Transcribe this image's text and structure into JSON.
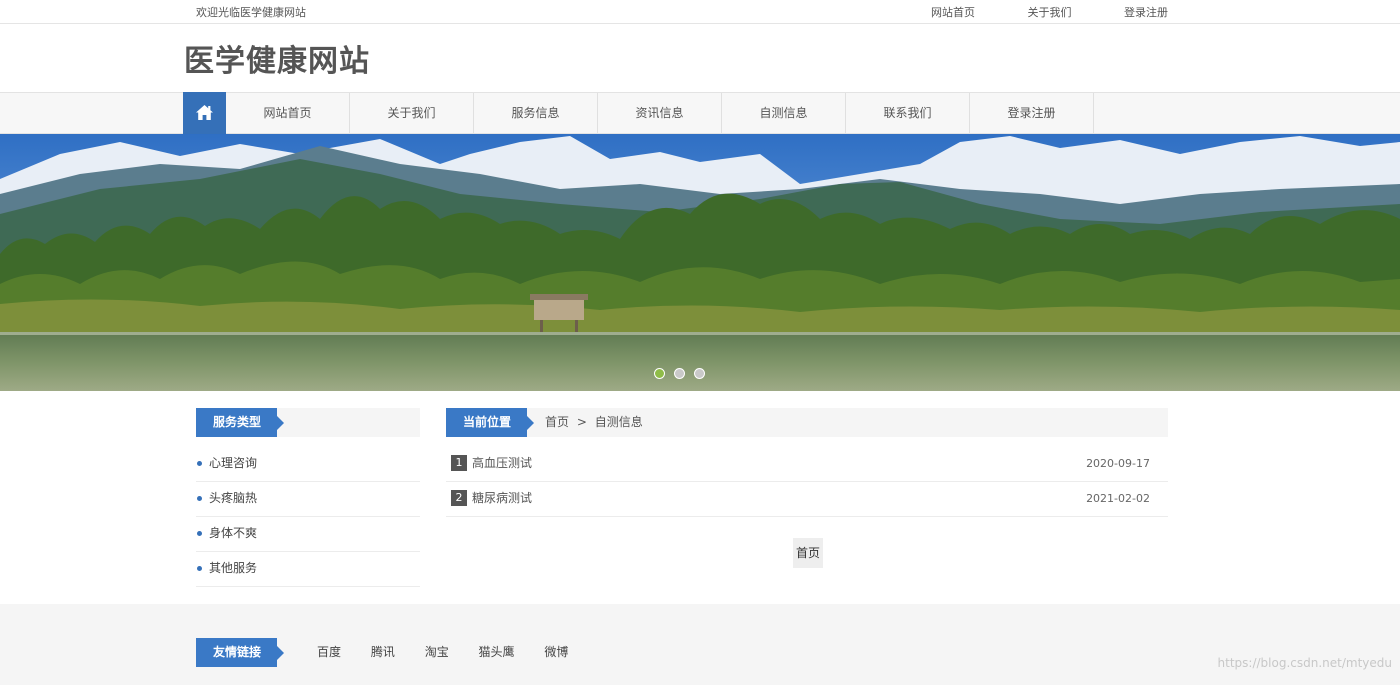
{
  "topbar": {
    "welcome": "欢迎光临医学健康网站",
    "links": [
      "网站首页",
      "关于我们",
      "登录注册"
    ]
  },
  "header": {
    "site_title": "医学健康网站"
  },
  "nav": {
    "home_icon": "home-icon",
    "items": [
      "网站首页",
      "关于我们",
      "服务信息",
      "资讯信息",
      "自测信息",
      "联系我们",
      "登录注册"
    ]
  },
  "banner": {
    "slide_count": 3,
    "active_slide": 1,
    "active_dot_color": "#8fbc48"
  },
  "sidebar": {
    "heading": "服务类型",
    "items": [
      "心理咨询",
      "头疼脑热",
      "身体不爽",
      "其他服务"
    ]
  },
  "content": {
    "location_label": "当前位置",
    "breadcrumb": {
      "home": "首页",
      "separator": ">",
      "current": "自测信息"
    },
    "rows": [
      {
        "num": "1",
        "title": "高血压测试",
        "date": "2020-09-17"
      },
      {
        "num": "2",
        "title": "糖尿病测试",
        "date": "2021-02-02"
      }
    ],
    "pager": {
      "first": "首页"
    }
  },
  "footer": {
    "heading": "友情链接",
    "links": [
      "百度",
      "腾讯",
      "淘宝",
      "猫头鹰",
      "微博"
    ],
    "watermark": "https://blog.csdn.net/mtyedu"
  },
  "colors": {
    "accent": "#3a79c6",
    "nav_home_bg": "#3570b8"
  }
}
